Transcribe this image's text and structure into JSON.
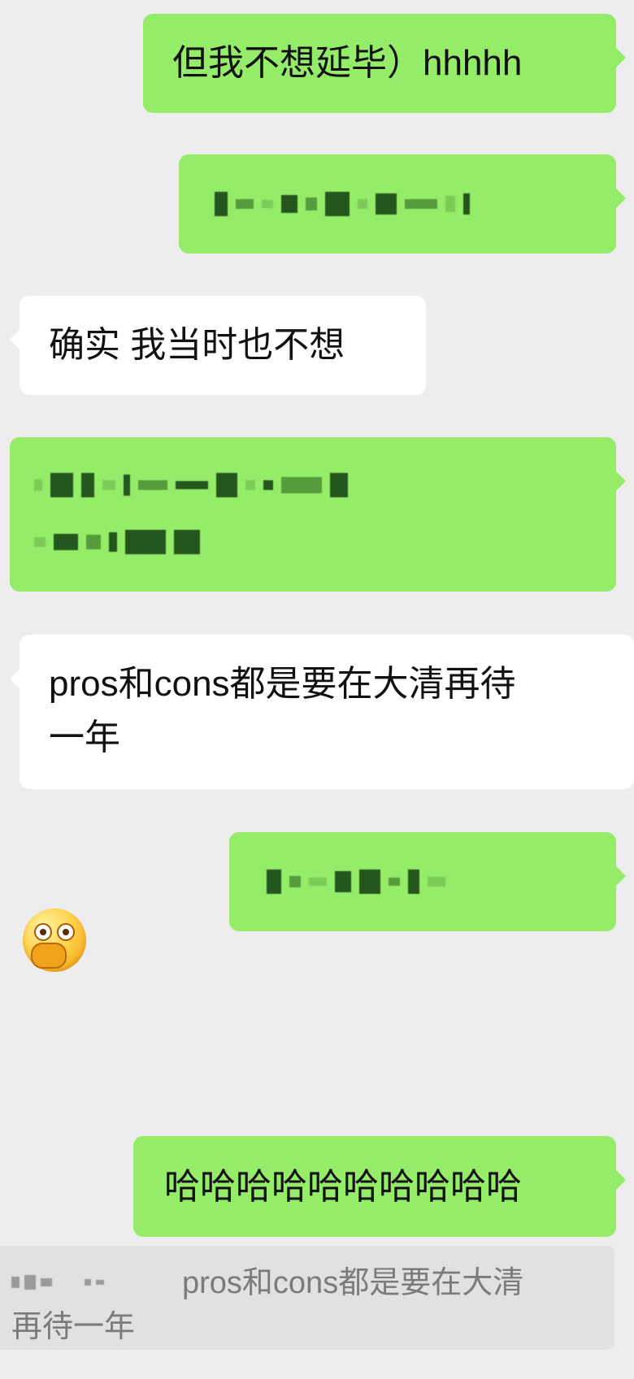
{
  "messages": [
    {
      "side": "out",
      "text": "但我不想延毕）hhhhh"
    },
    {
      "side": "out",
      "text": "",
      "redacted": true
    },
    {
      "side": "in",
      "text": "确实 我当时也不想"
    },
    {
      "side": "out",
      "text": "",
      "redacted": true
    },
    {
      "side": "in",
      "text": "pros和cons都是要在大清再待\n一年"
    },
    {
      "side": "out",
      "text": "",
      "redacted": true
    },
    {
      "side": "in",
      "type": "emoji",
      "icon": "cover-mouth-emoji-icon"
    },
    {
      "side": "out",
      "text": "哈哈哈哈哈哈哈哈哈哈"
    }
  ],
  "quote": {
    "line1": "pros和cons都是要在大清",
    "line2": "再待一年"
  },
  "colors": {
    "background": "#ededed",
    "outgoing_bubble": "#95ec69",
    "incoming_bubble": "#ffffff",
    "quote_bar": "#e1e1e1"
  }
}
